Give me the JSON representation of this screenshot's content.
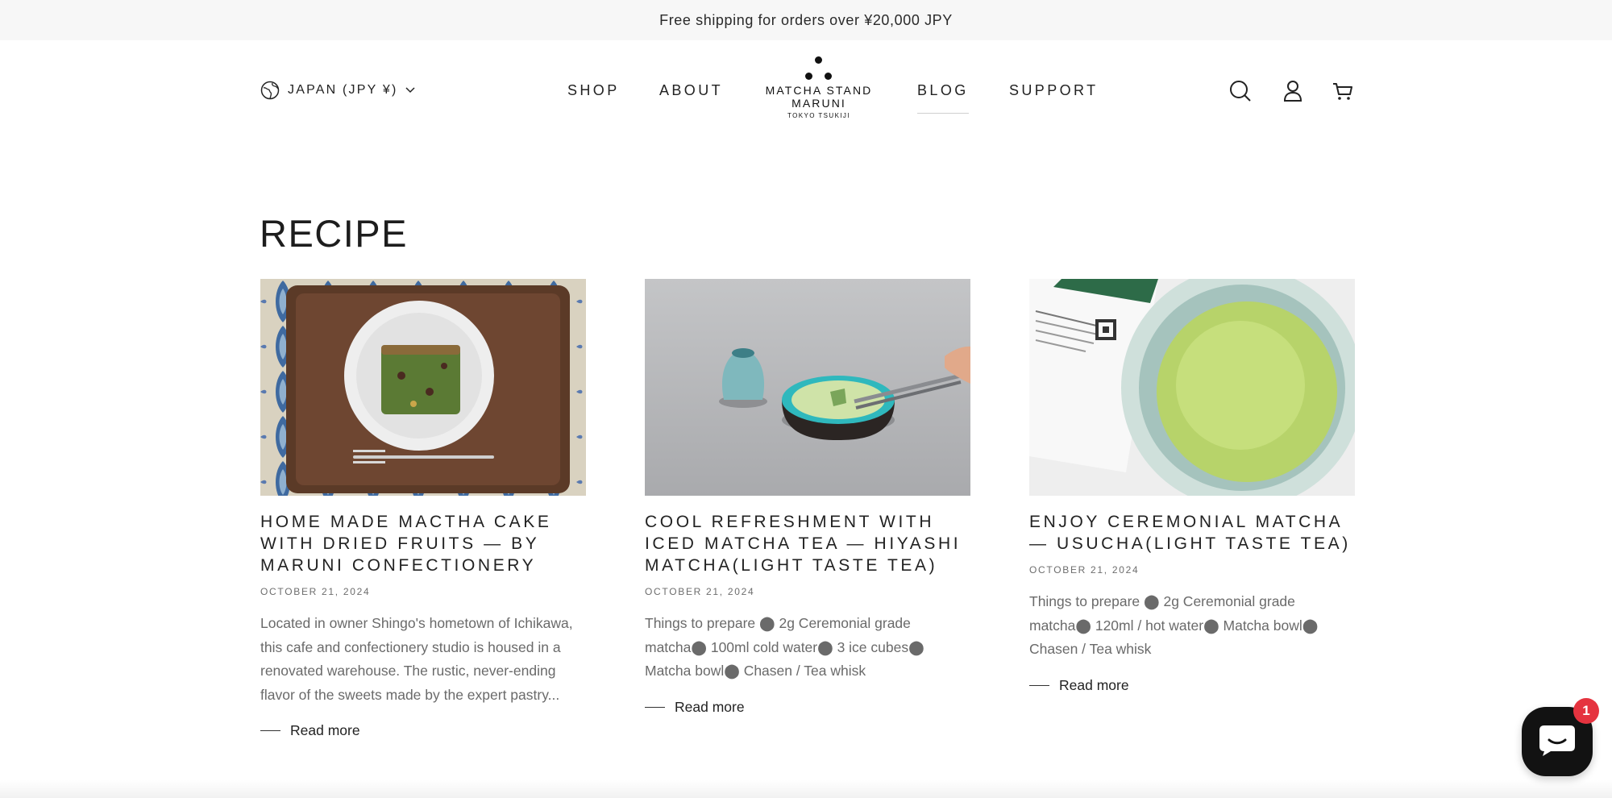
{
  "announcement": "Free shipping for orders over ¥20,000 JPY",
  "header": {
    "country_selector": "JAPAN (JPY ¥)",
    "nav": {
      "shop": "SHOP",
      "about": "ABOUT",
      "blog": "BLOG",
      "support": "SUPPORT"
    },
    "logo": {
      "line1": "MATCHA STAND",
      "line2": "MARUNI",
      "line3": "TOKYO TSUKIJI"
    },
    "icons": [
      "search-icon",
      "account-icon",
      "cart-icon"
    ]
  },
  "page": {
    "title": "RECIPE"
  },
  "articles": [
    {
      "title": "HOME MADE MACTHA CAKE WITH DRIED FRUITS — BY MARUNI CONFECTIONERY",
      "date": "OCTOBER 21, 2024",
      "excerpt": "Located in owner Shingo's hometown of Ichikawa, this cafe and confectionery studio is housed in a renovated warehouse. The rustic, never-ending flavor of the sweets made by the expert pastry...",
      "read_more": "Read more"
    },
    {
      "title": "COOL REFRESHMENT WITH ICED MATCHA TEA — HIYASHI MATCHA(LIGHT TASTE TEA)",
      "date": "OCTOBER 21, 2024",
      "excerpt": "Things to prepare ⬤ 2g Ceremonial grade matcha⬤ 100ml cold water⬤ 3 ice cubes⬤ Matcha bowl⬤ Chasen / Tea whisk",
      "read_more": "Read more"
    },
    {
      "title": "ENJOY CEREMONIAL MATCHA — USUCHA(LIGHT TASTE TEA)",
      "date": "OCTOBER 21, 2024",
      "excerpt": "Things to prepare ⬤ 2g Ceremonial grade matcha⬤ 120ml / hot water⬤ Matcha bowl⬤ Chasen / Tea whisk",
      "read_more": "Read more"
    }
  ],
  "chat": {
    "badge_count": "1"
  },
  "colors": {
    "announcement_bg": "#f7f7f7",
    "text": "#222222",
    "muted_text": "#6a6a6a",
    "chat_bg": "#121212",
    "badge": "#e5333f"
  }
}
